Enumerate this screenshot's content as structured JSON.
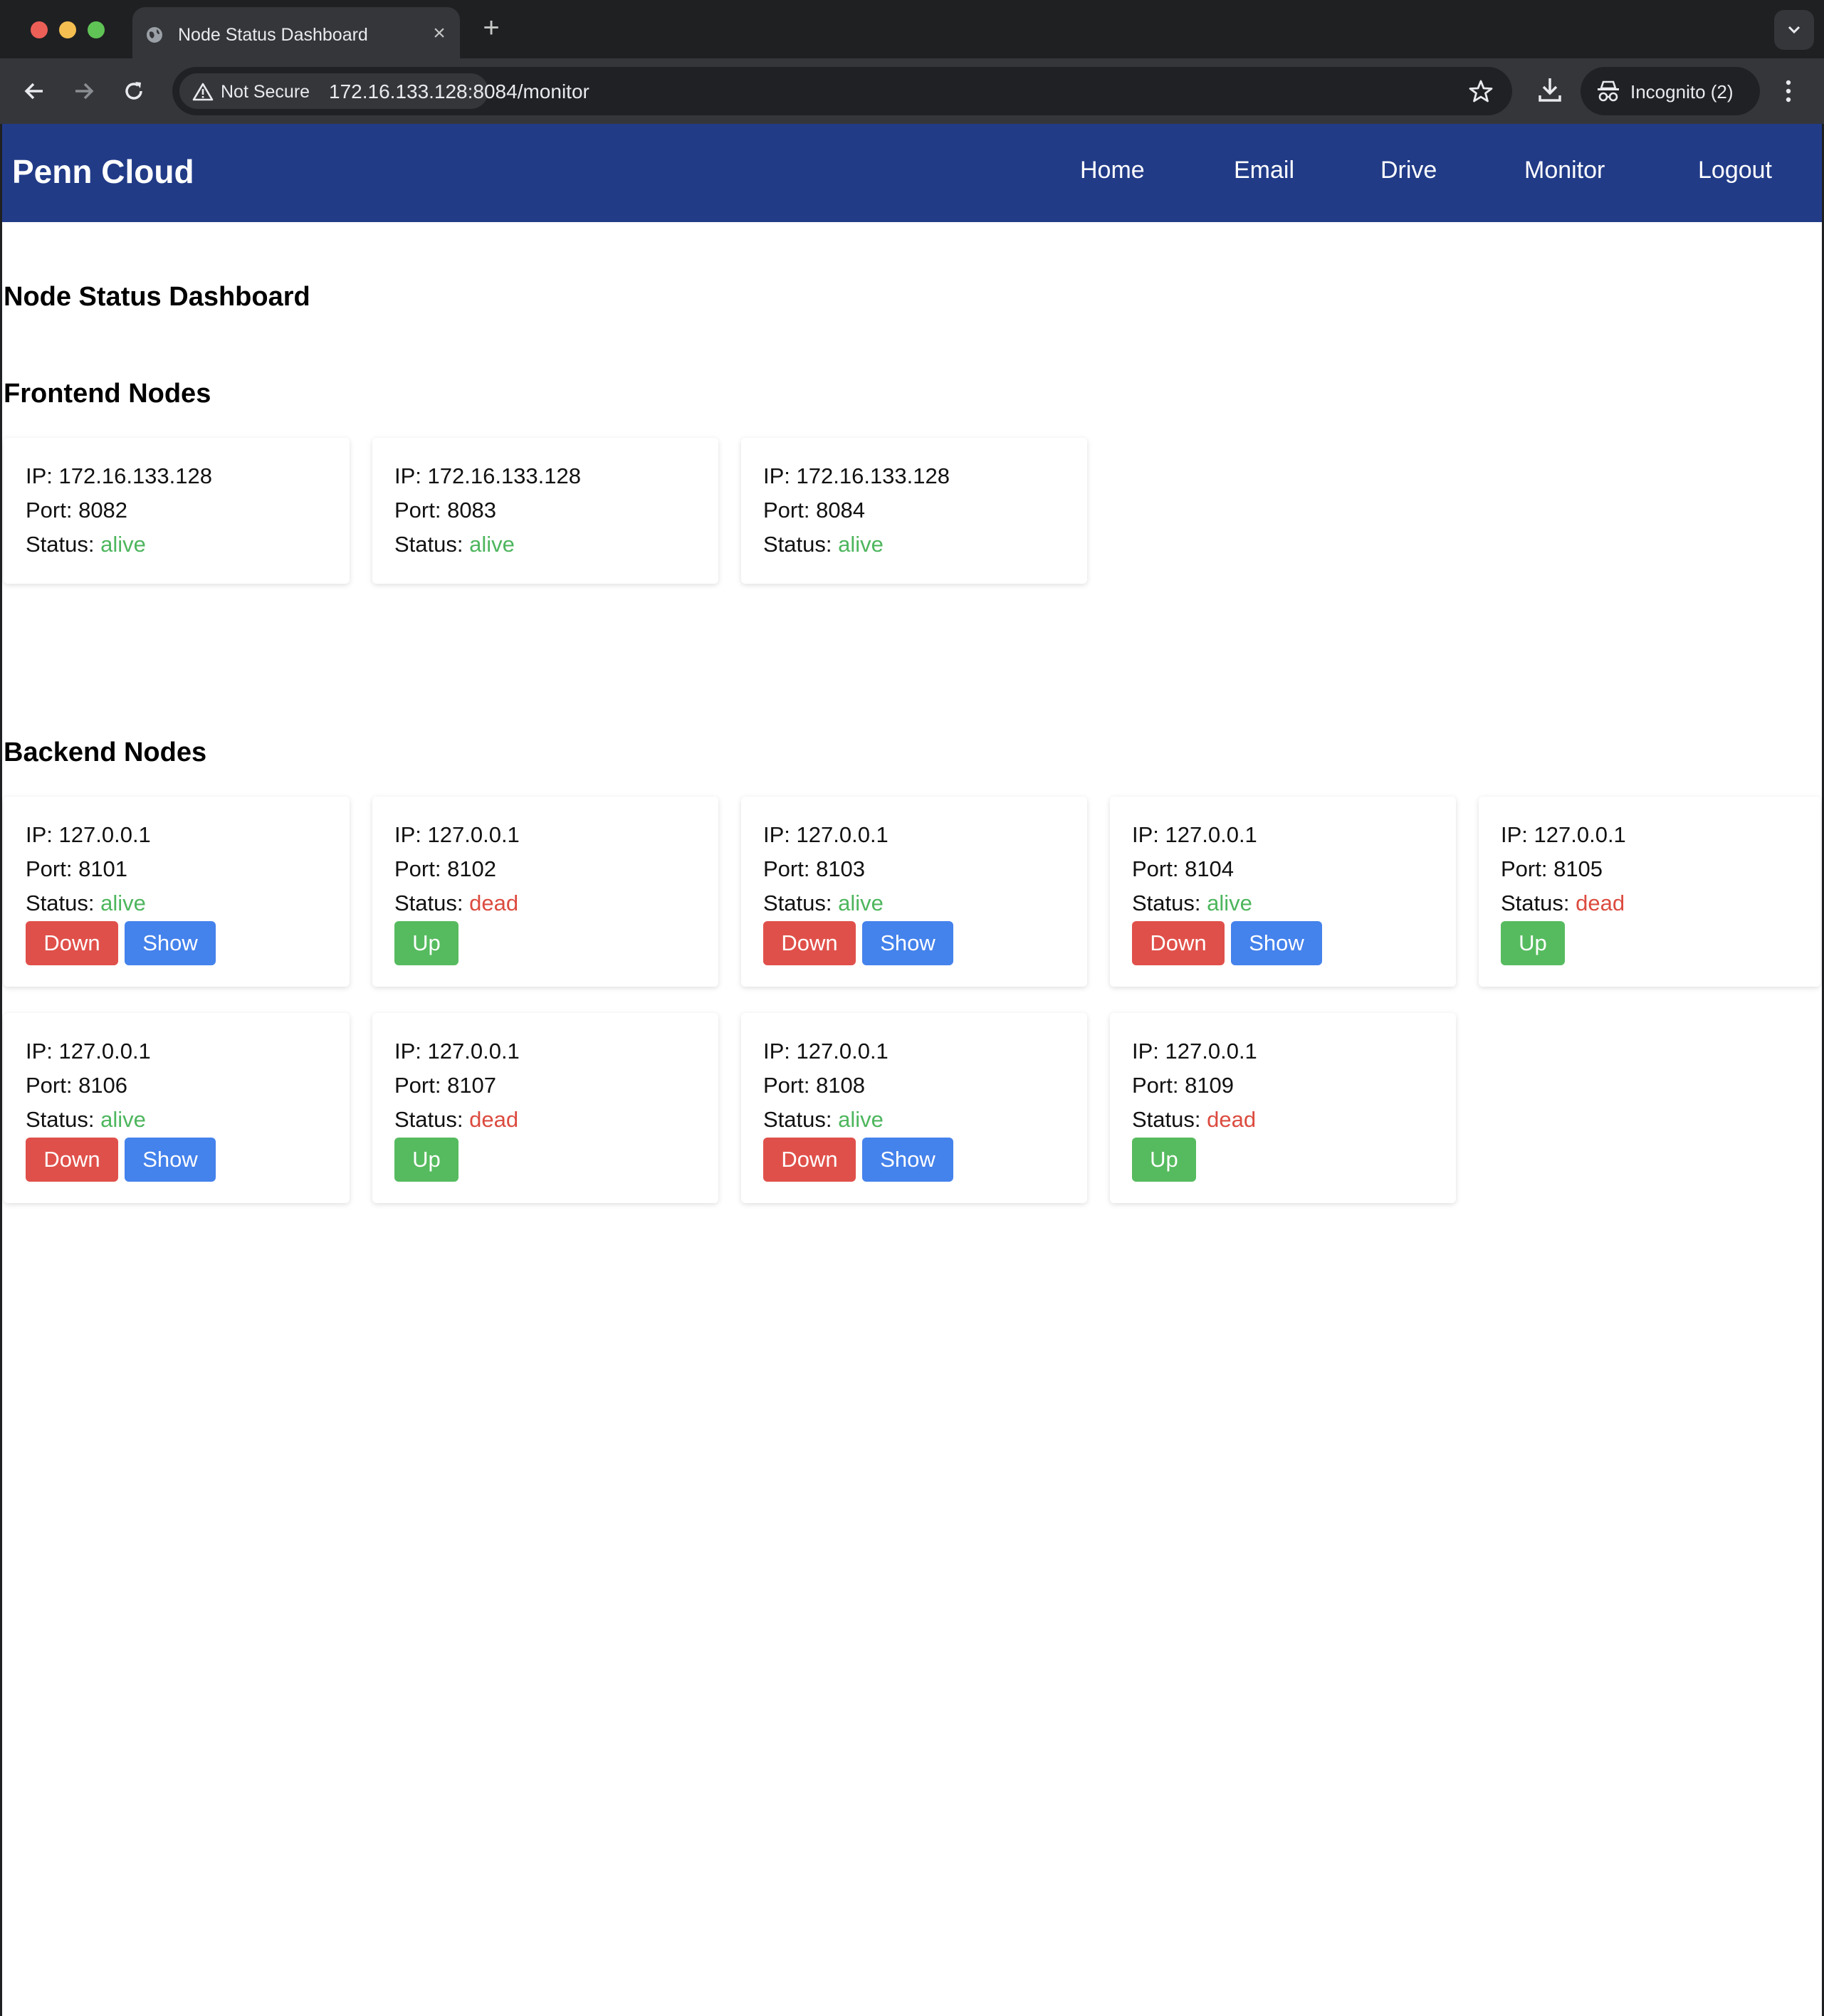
{
  "browser": {
    "tab_title": "Node Status Dashboard",
    "security_label": "Not Secure",
    "url": "172.16.133.128:8084/monitor",
    "profile_label": "Incognito (2)"
  },
  "navbar": {
    "brand": "Penn Cloud",
    "links": [
      "Home",
      "Email",
      "Drive",
      "Monitor",
      "Logout"
    ],
    "background_color": "#213b87"
  },
  "page": {
    "title": "Node Status Dashboard"
  },
  "frontend": {
    "title": "Frontend Nodes",
    "nodes": [
      {
        "ip": "IP: 172.16.133.128",
        "port": "Port: 8082",
        "status_label": "Status:",
        "status": "alive"
      },
      {
        "ip": "IP: 172.16.133.128",
        "port": "Port: 8083",
        "status_label": "Status:",
        "status": "alive"
      },
      {
        "ip": "IP: 172.16.133.128",
        "port": "Port: 8084",
        "status_label": "Status:",
        "status": "alive"
      }
    ]
  },
  "backend": {
    "title": "Backend Nodes",
    "nodes": [
      {
        "ip": "IP: 127.0.0.1",
        "port": "Port: 8101",
        "status_label": "Status:",
        "status": "alive",
        "down_label": "Down",
        "show_label": "Show"
      },
      {
        "ip": "IP: 127.0.0.1",
        "port": "Port: 8102",
        "status_label": "Status:",
        "status": "dead",
        "up_label": "Up"
      },
      {
        "ip": "IP: 127.0.0.1",
        "port": "Port: 8103",
        "status_label": "Status:",
        "status": "alive",
        "down_label": "Down",
        "show_label": "Show"
      },
      {
        "ip": "IP: 127.0.0.1",
        "port": "Port: 8104",
        "status_label": "Status:",
        "status": "alive",
        "down_label": "Down",
        "show_label": "Show"
      },
      {
        "ip": "IP: 127.0.0.1",
        "port": "Port: 8105",
        "status_label": "Status:",
        "status": "dead",
        "up_label": "Up"
      },
      {
        "ip": "IP: 127.0.0.1",
        "port": "Port: 8106",
        "status_label": "Status:",
        "status": "alive",
        "down_label": "Down",
        "show_label": "Show"
      },
      {
        "ip": "IP: 127.0.0.1",
        "port": "Port: 8107",
        "status_label": "Status:",
        "status": "dead",
        "up_label": "Up"
      },
      {
        "ip": "IP: 127.0.0.1",
        "port": "Port: 8108",
        "status_label": "Status:",
        "status": "alive",
        "down_label": "Down",
        "show_label": "Show"
      },
      {
        "ip": "IP: 127.0.0.1",
        "port": "Port: 8109",
        "status_label": "Status:",
        "status": "dead",
        "up_label": "Up"
      }
    ]
  },
  "colors": {
    "alive": "#4db65d",
    "dead": "#dc4b3f",
    "down_button": "#e0504a",
    "show_button": "#4482ec",
    "up_button": "#56bb5f"
  }
}
